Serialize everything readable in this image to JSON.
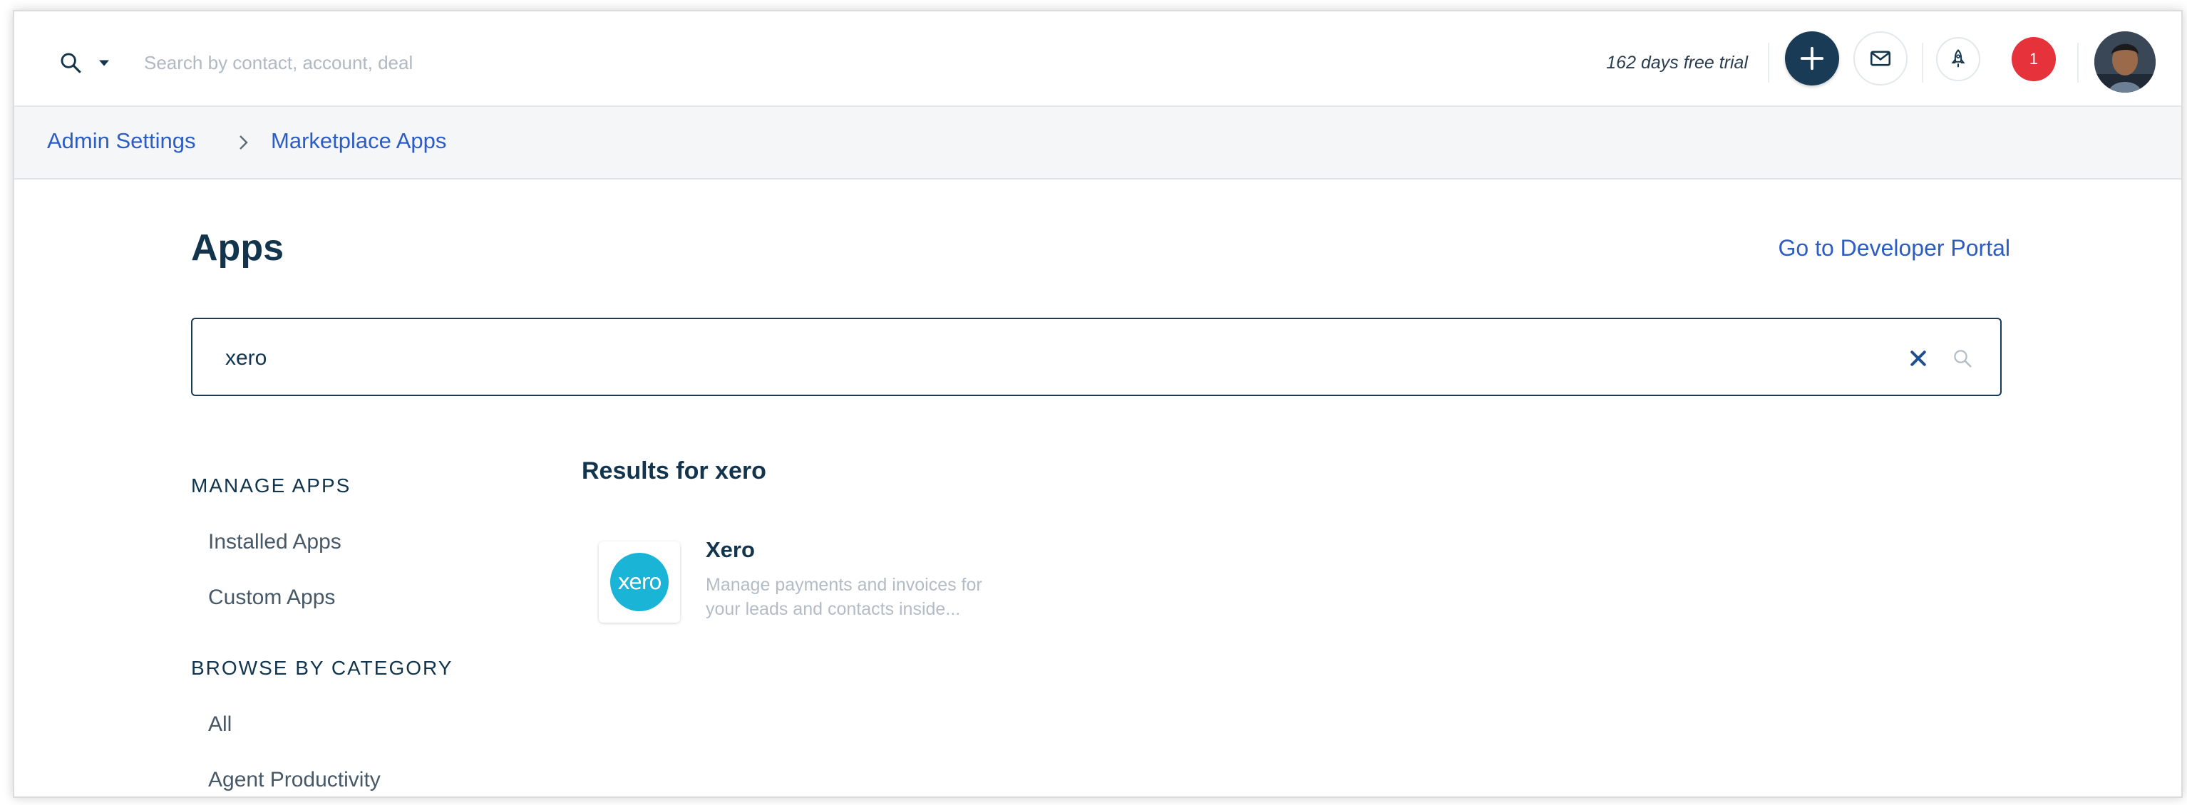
{
  "topbar": {
    "search_placeholder": "Search by contact, account, deal",
    "trial_text": "162 days free trial",
    "notification_count": "1",
    "brand_color": "#1a3b55",
    "badge_color": "#e5323b"
  },
  "breadcrumb": {
    "items": [
      "Admin Settings",
      "Marketplace Apps"
    ]
  },
  "page": {
    "title": "Apps",
    "developer_portal_link": "Go to Developer Portal",
    "search_value": "xero"
  },
  "sidebar": {
    "manage_heading": "MANAGE APPS",
    "manage_items": [
      "Installed Apps",
      "Custom Apps"
    ],
    "category_heading": "BROWSE BY CATEGORY",
    "category_items": [
      "All",
      "Agent Productivity"
    ]
  },
  "results": {
    "title": "Results for xero",
    "apps": [
      {
        "name": "Xero",
        "logo_text": "xero",
        "description": "Manage payments and invoices for your leads and contacts inside...",
        "logo_color": "#1ab4d7"
      }
    ]
  }
}
